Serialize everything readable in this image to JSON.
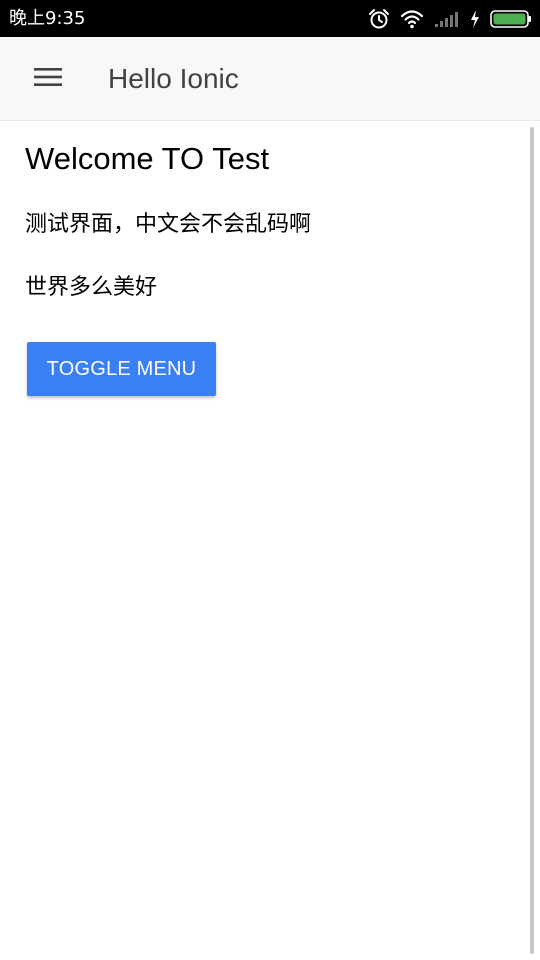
{
  "status_bar": {
    "time": "晚上9:35",
    "icons": [
      "alarm-icon",
      "wifi-icon",
      "signal-icon",
      "charging-icon",
      "battery-icon"
    ],
    "battery_color": "#4caf50"
  },
  "toolbar": {
    "title": "Hello Ionic",
    "menu_icon": "hamburger-menu-icon"
  },
  "content": {
    "heading": "Welcome TO Test",
    "paragraphs": [
      "测试界面，中文会不会乱码啊",
      "世界多么美好"
    ],
    "toggle_button_label": "TOGGLE MENU"
  },
  "colors": {
    "primary": "#3880f4",
    "toolbar_bg": "#f8f8f8",
    "status_bar_bg": "#000000"
  }
}
